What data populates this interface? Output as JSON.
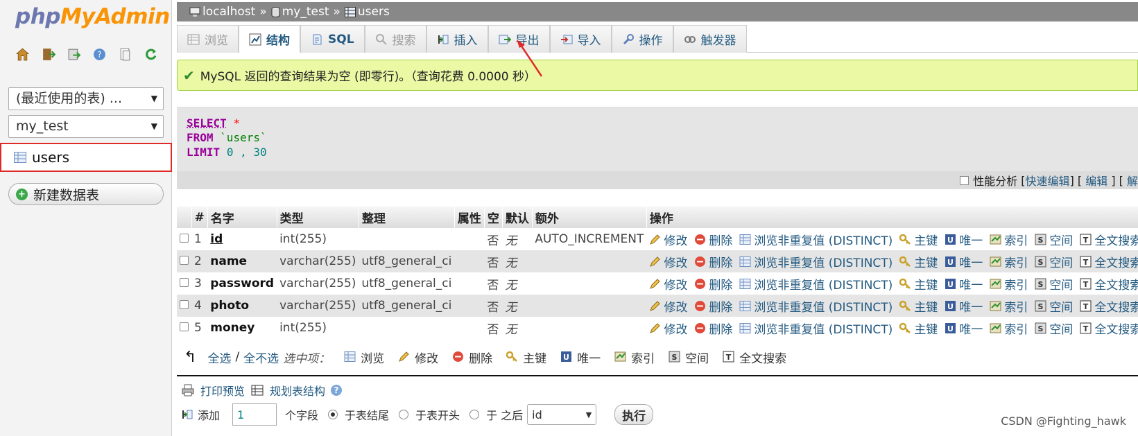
{
  "logo": {
    "part1": "php",
    "part2": "MyAdmin"
  },
  "nav": {
    "icons": [
      "home-icon",
      "exit-icon",
      "sql-query-icon",
      "help-icon",
      "docs-icon",
      "reload-icon"
    ],
    "recent_label": "(最近使用的表) ...",
    "db_value": "my_test",
    "table_item": "users",
    "new_table": "新建数据表"
  },
  "breadcrumb": {
    "server": "localhost",
    "db": "my_test",
    "table": "users",
    "sep": "»"
  },
  "tabs": [
    {
      "label": "浏览",
      "icon": "browse-icon",
      "state": "disabled"
    },
    {
      "label": "结构",
      "icon": "structure-icon",
      "state": "active"
    },
    {
      "label": "SQL",
      "icon": "sql-icon",
      "state": "sql"
    },
    {
      "label": "搜索",
      "icon": "search-icon",
      "state": "disabled"
    },
    {
      "label": "插入",
      "icon": "insert-icon",
      "state": ""
    },
    {
      "label": "导出",
      "icon": "export-icon",
      "state": ""
    },
    {
      "label": "导入",
      "icon": "import-icon",
      "state": ""
    },
    {
      "label": "操作",
      "icon": "wrench-icon",
      "state": ""
    },
    {
      "label": "触发器",
      "icon": "trigger-icon",
      "state": ""
    }
  ],
  "message": "MySQL 返回的查询结果为空 (即零行)。（查询花费 0.0000 秒）",
  "sql": {
    "select": "SELECT",
    "star": "*",
    "from": "FROM",
    "table": "`users`",
    "limit": "LIMIT",
    "offset": "0",
    "comma": ",",
    "count": "30"
  },
  "sqlbar": {
    "profiling": "性能分析",
    "inline_edit": "快速编辑",
    "edit": "编辑",
    "explain": "解"
  },
  "table": {
    "headers": [
      "#",
      "名字",
      "类型",
      "整理",
      "属性",
      "空",
      "默认",
      "额外",
      "操作"
    ],
    "rows": [
      {
        "num": "1",
        "name": "id",
        "type": "int(255)",
        "collation": "",
        "attr": "",
        "null": "否",
        "default": "无",
        "extra": "AUTO_INCREMENT"
      },
      {
        "num": "2",
        "name": "name",
        "type": "varchar(255)",
        "collation": "utf8_general_ci",
        "attr": "",
        "null": "否",
        "default": "无",
        "extra": ""
      },
      {
        "num": "3",
        "name": "password",
        "type": "varchar(255)",
        "collation": "utf8_general_ci",
        "attr": "",
        "null": "否",
        "default": "无",
        "extra": ""
      },
      {
        "num": "4",
        "name": "photo",
        "type": "varchar(255)",
        "collation": "utf8_general_ci",
        "attr": "",
        "null": "否",
        "default": "无",
        "extra": ""
      },
      {
        "num": "5",
        "name": "money",
        "type": "int(255)",
        "collation": "",
        "attr": "",
        "null": "否",
        "default": "无",
        "extra": ""
      }
    ],
    "actions": [
      "修改",
      "删除",
      "浏览非重复值 (DISTINCT)",
      "主键",
      "唯一",
      "索引",
      "空间",
      "全文搜索"
    ]
  },
  "bulk": {
    "check_all": "全选",
    "slash": "/",
    "uncheck_all": "全不选",
    "with_selected": "选中项：",
    "actions": [
      "浏览",
      "修改",
      "删除",
      "主键",
      "唯一",
      "索引",
      "空间",
      "全文搜索"
    ]
  },
  "print": {
    "print_view": "打印预览",
    "propose": "规划表结构"
  },
  "add": {
    "prefix": "添加",
    "count": "1",
    "fields": "个字段",
    "at_end": "于表结尾",
    "at_begin": "于表开头",
    "after": "于 之后",
    "after_col": "id",
    "go": "执行"
  },
  "watermark": "CSDN @Fighting_hawk",
  "colors": {
    "accent": "#235a81",
    "success_bg": "#ebf8a4",
    "highlight": "#e02a2a"
  }
}
